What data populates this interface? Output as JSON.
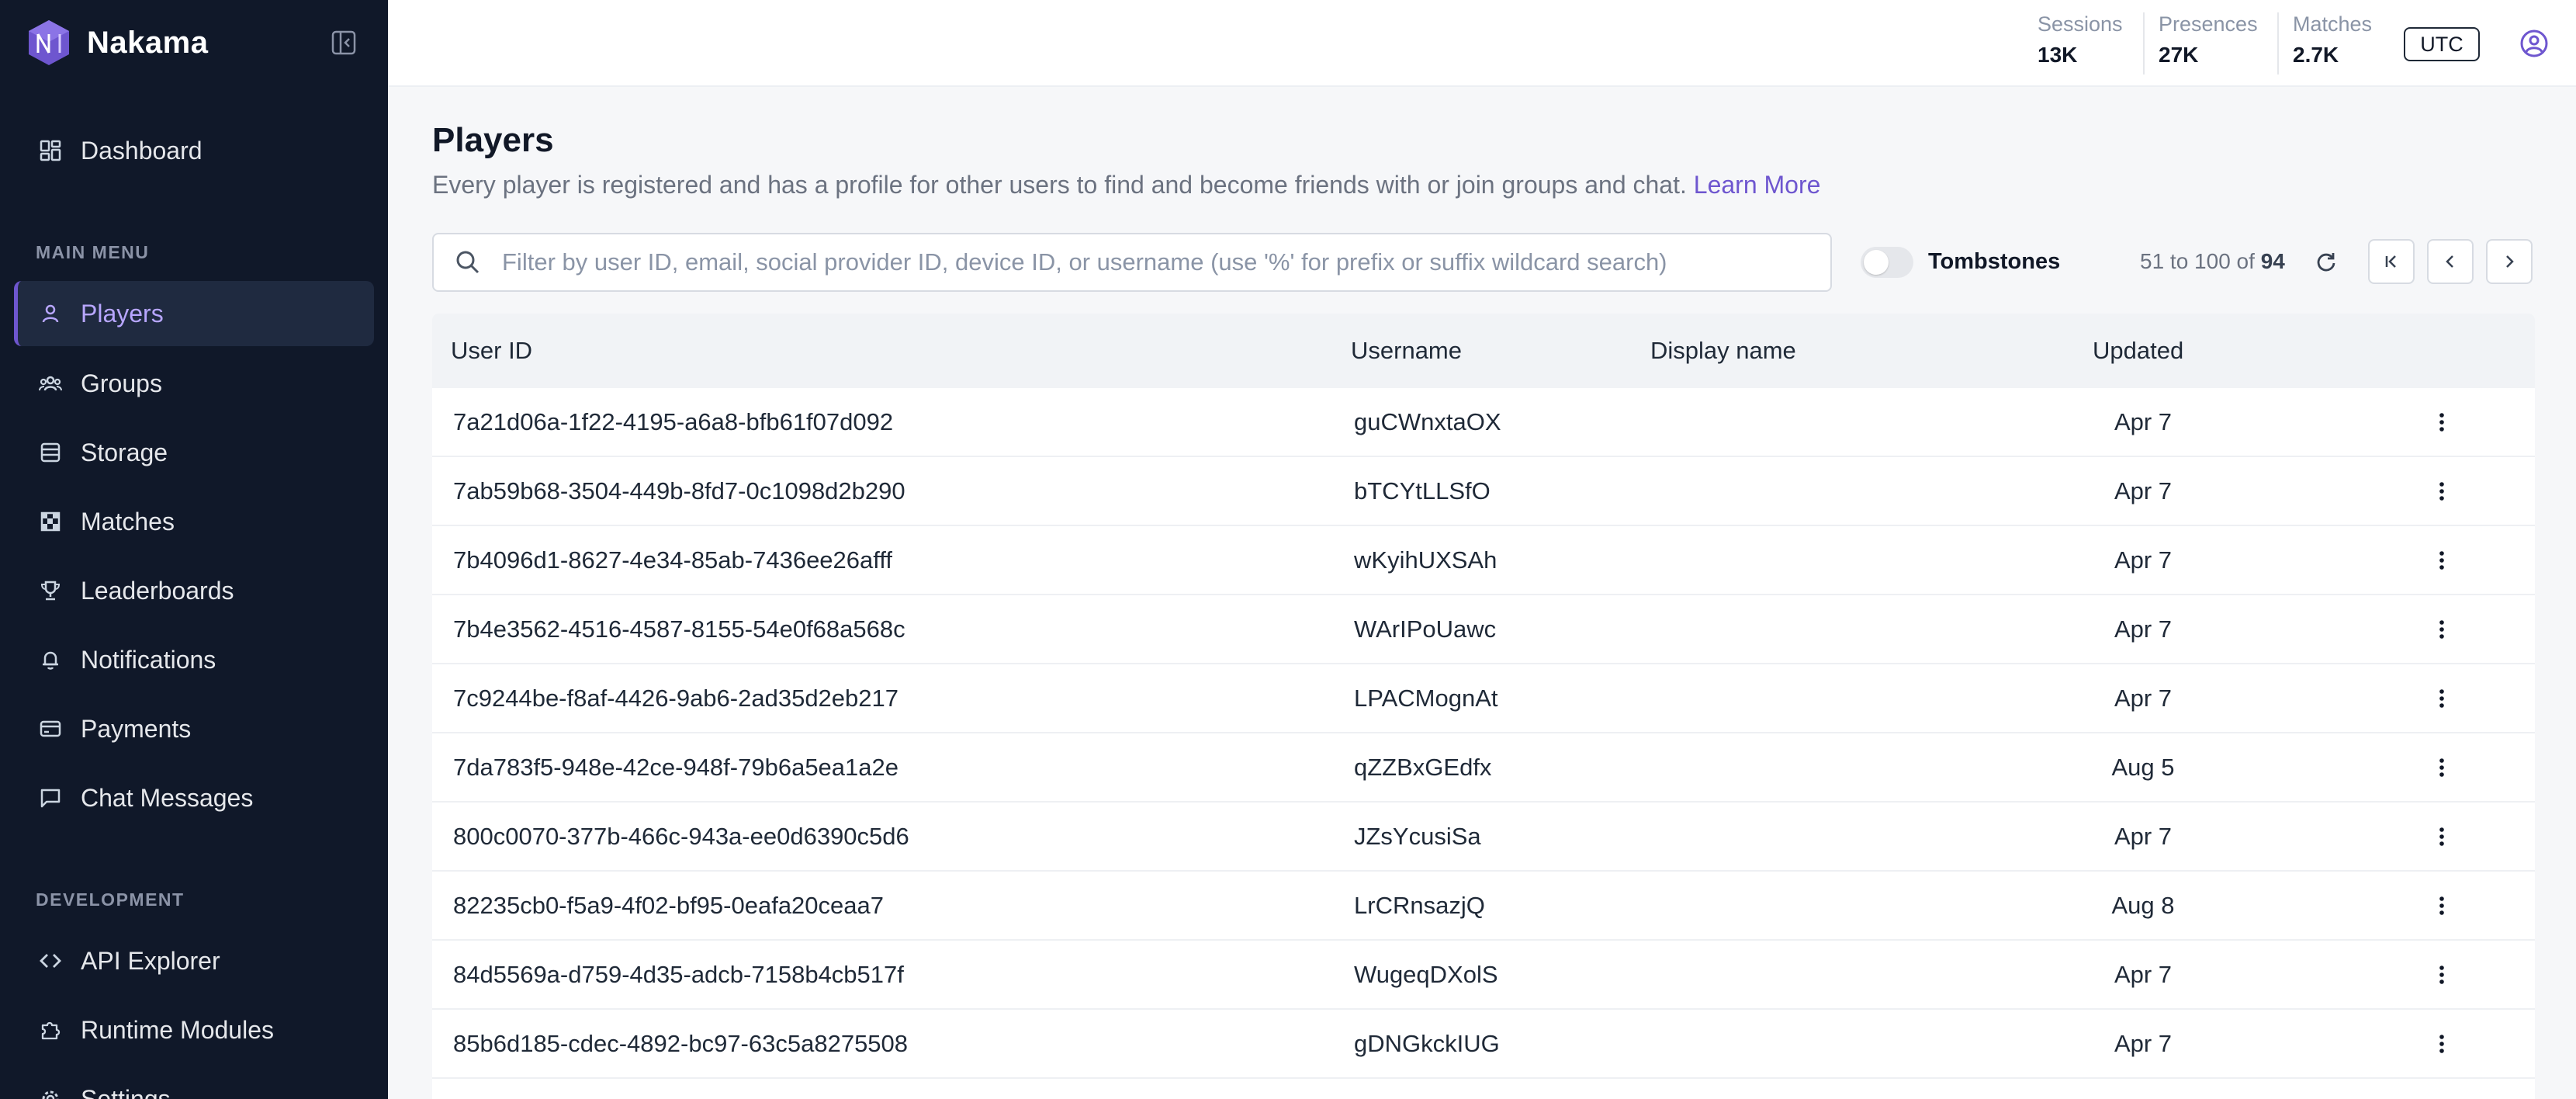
{
  "app": {
    "name": "Nakama"
  },
  "sidebar": {
    "items_top": [
      {
        "label": "Dashboard",
        "icon": "dashboard-icon"
      }
    ],
    "main_menu_label": "MAIN MENU",
    "main_menu": [
      {
        "label": "Players",
        "icon": "user-icon",
        "active": true
      },
      {
        "label": "Groups",
        "icon": "users-icon"
      },
      {
        "label": "Storage",
        "icon": "database-icon"
      },
      {
        "label": "Matches",
        "icon": "checkerboard-icon"
      },
      {
        "label": "Leaderboards",
        "icon": "trophy-icon"
      },
      {
        "label": "Notifications",
        "icon": "bell-icon"
      },
      {
        "label": "Payments",
        "icon": "credit-card-icon"
      },
      {
        "label": "Chat Messages",
        "icon": "chat-icon"
      }
    ],
    "development_label": "DEVELOPMENT",
    "development": [
      {
        "label": "API Explorer",
        "icon": "code-icon"
      },
      {
        "label": "Runtime Modules",
        "icon": "puzzle-icon"
      },
      {
        "label": "Settings",
        "icon": "gear-icon"
      }
    ]
  },
  "topbar": {
    "stats": [
      {
        "label": "Sessions",
        "value": "13K"
      },
      {
        "label": "Presences",
        "value": "27K"
      },
      {
        "label": "Matches",
        "value": "2.7K"
      }
    ],
    "timezone": "UTC"
  },
  "page": {
    "title": "Players",
    "description": "Every player is registered and has a profile for other users to find and become friends with or join groups and chat.",
    "learn_more": "Learn More",
    "search_placeholder": "Filter by user ID, email, social provider ID, device ID, or username (use '%' for prefix or suffix wildcard search)",
    "search_value": "",
    "tombstones_label": "Tombstones",
    "tombstones_on": false,
    "range_text": "51 to 100 of",
    "total": "94"
  },
  "table": {
    "columns": [
      "User ID",
      "Username",
      "Display name",
      "Updated"
    ],
    "rows": [
      {
        "user_id": "7a21d06a-1f22-4195-a6a8-bfb61f07d092",
        "username": "guCWnxtaOX",
        "display_name": "",
        "updated": "Apr 7"
      },
      {
        "user_id": "7ab59b68-3504-449b-8fd7-0c1098d2b290",
        "username": "bTCYtLLSfO",
        "display_name": "",
        "updated": "Apr 7"
      },
      {
        "user_id": "7b4096d1-8627-4e34-85ab-7436ee26afff",
        "username": "wKyihUXSAh",
        "display_name": "",
        "updated": "Apr 7"
      },
      {
        "user_id": "7b4e3562-4516-4587-8155-54e0f68a568c",
        "username": "WArIPoUawc",
        "display_name": "",
        "updated": "Apr 7"
      },
      {
        "user_id": "7c9244be-f8af-4426-9ab6-2ad35d2eb217",
        "username": "LPACMognAt",
        "display_name": "",
        "updated": "Apr 7"
      },
      {
        "user_id": "7da783f5-948e-42ce-948f-79b6a5ea1a2e",
        "username": "qZZBxGEdfx",
        "display_name": "",
        "updated": "Aug 5"
      },
      {
        "user_id": "800c0070-377b-466c-943a-ee0d6390c5d6",
        "username": "JZsYcusiSa",
        "display_name": "",
        "updated": "Apr 7"
      },
      {
        "user_id": "82235cb0-f5a9-4f02-bf95-0eafa20ceaa7",
        "username": "LrCRnsazjQ",
        "display_name": "",
        "updated": "Aug 8"
      },
      {
        "user_id": "84d5569a-d759-4d35-adcb-7158b4cb517f",
        "username": "WugeqDXolS",
        "display_name": "",
        "updated": "Apr 7"
      },
      {
        "user_id": "85b6d185-cdec-4892-bc97-63c5a8275508",
        "username": "gDNGkckIUG",
        "display_name": "",
        "updated": "Apr 7"
      }
    ]
  },
  "colors": {
    "sidebar_bg": "#101829",
    "accent": "#6e56cf",
    "main_bg": "#f6f7f9"
  }
}
